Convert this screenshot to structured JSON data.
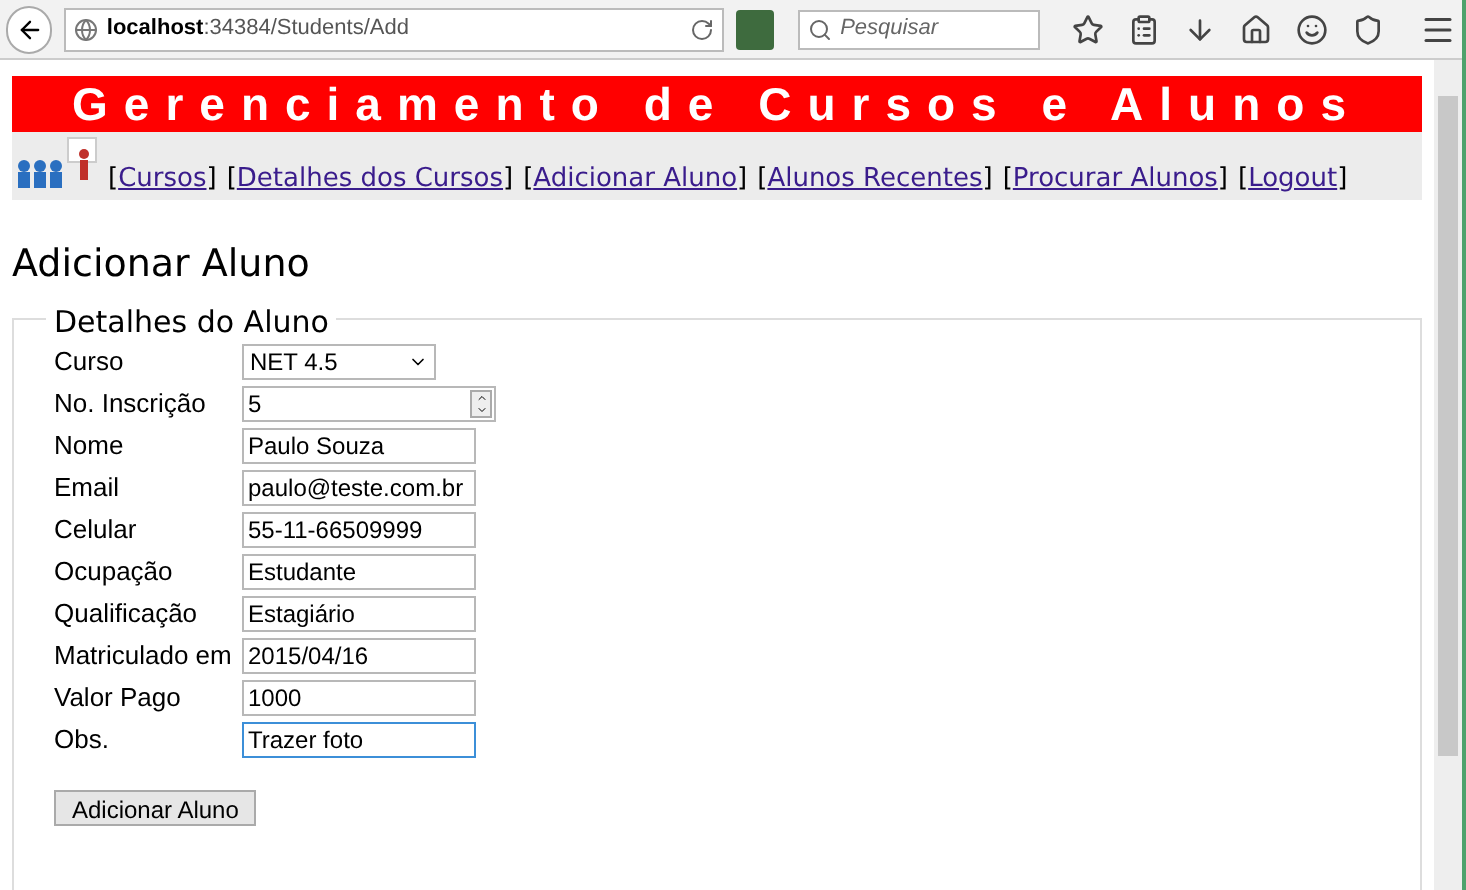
{
  "browser": {
    "url_host": "localhost",
    "url_path": ":34384/Students/Add",
    "search": {
      "placeholder": "Pesquisar"
    }
  },
  "banner": {
    "title": "Gerenciamento de Cursos e Alunos"
  },
  "nav": [
    {
      "label": "Cursos"
    },
    {
      "label": "Detalhes dos Cursos"
    },
    {
      "label": "Adicionar Aluno"
    },
    {
      "label": "Alunos Recentes"
    },
    {
      "label": "Procurar Alunos"
    },
    {
      "label": "Logout"
    }
  ],
  "nav_brackets": {
    "open": "[",
    "close": "]"
  },
  "page_title": "Adicionar Aluno",
  "form": {
    "legend": "Detalhes do Aluno",
    "fields": [
      {
        "label": "Curso",
        "kind": "select",
        "value": "NET 4.5",
        "focused": false
      },
      {
        "label": "No. Inscrição",
        "kind": "number",
        "value": "5",
        "focused": false
      },
      {
        "label": "Nome",
        "kind": "text",
        "value": "Paulo Souza",
        "focused": false
      },
      {
        "label": "Email",
        "kind": "text",
        "value": "paulo@teste.com.br",
        "focused": false
      },
      {
        "label": "Celular",
        "kind": "text",
        "value": "55-11-66509999",
        "focused": false
      },
      {
        "label": "Ocupação",
        "kind": "text",
        "value": "Estudante",
        "focused": false
      },
      {
        "label": "Qualificação",
        "kind": "text",
        "value": "Estagiário",
        "focused": false
      },
      {
        "label": "Matriculado em",
        "kind": "text",
        "value": "2015/04/16",
        "focused": false
      },
      {
        "label": "Valor Pago",
        "kind": "text",
        "value": "1000",
        "focused": false
      },
      {
        "label": "Obs.",
        "kind": "text",
        "value": "Trazer foto",
        "focused": true
      }
    ],
    "submit": "Adicionar Aluno"
  }
}
